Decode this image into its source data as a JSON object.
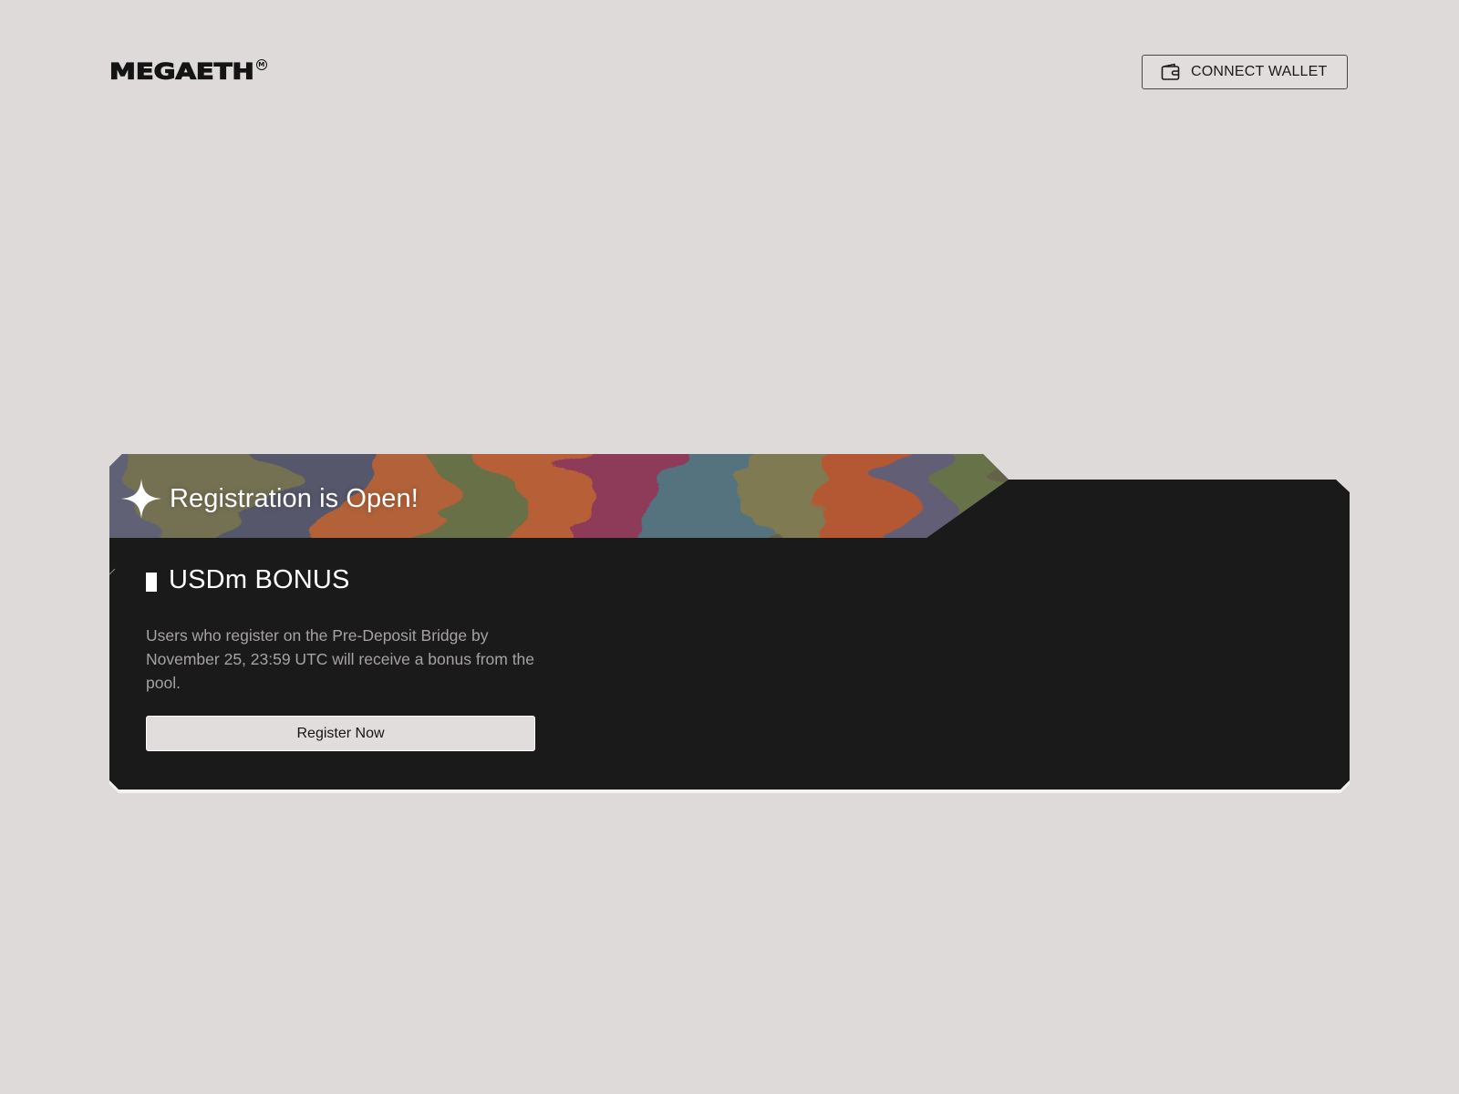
{
  "header": {
    "logo_text": "MEGAETH",
    "logo_mark": "M",
    "connect_wallet_label": "CONNECT WALLET",
    "wallet_icon": "wallet-icon"
  },
  "card": {
    "banner_title": "Registration is Open!",
    "banner_icon": "sparkle-icon",
    "section_title": "USDm BONUS",
    "description": "Users who register on the Pre-Deposit Bridge by November 25, 23:59 UTC will receive a bonus from the pool.",
    "register_button_label": "Register Now"
  },
  "colors": {
    "page_background": "#dfdada",
    "card_background": "#1b1a1a",
    "text_light": "#ffffff",
    "text_muted": "#a6a2a2",
    "button_background": "#e2dddd"
  }
}
